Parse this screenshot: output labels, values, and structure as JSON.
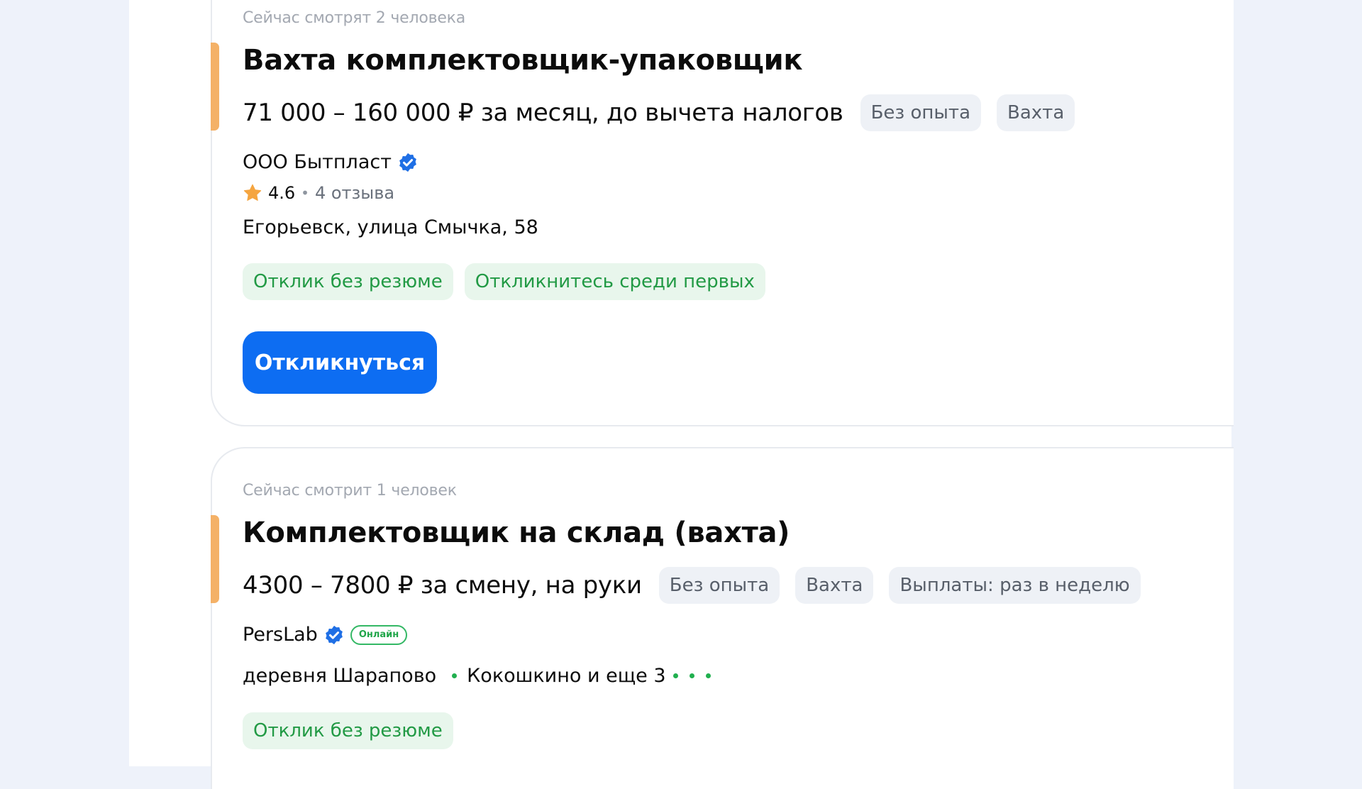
{
  "vacancies": [
    {
      "viewers": "Сейчас смотрят 2 человека",
      "title": "Вахта комплектовщик-упаковщик",
      "salary": "71 000 – 160 000 ₽ за месяц, до вычета налогов",
      "tags": [
        "Без опыта",
        "Вахта"
      ],
      "company": "ООО Бытпласт",
      "rating": "4.6",
      "reviews": "4 отзыва",
      "address": "Егорьевск, улица Смычка, 58",
      "chips": [
        "Отклик без резюме",
        "Откликнитесь среди первых"
      ],
      "apply_label": "Откликнуться"
    },
    {
      "viewers": "Сейчас смотрит 1 человек",
      "title": "Комплектовщик на склад (вахта)",
      "salary": "4300 – 7800 ₽ за смену, на руки",
      "tags": [
        "Без опыта",
        "Вахта",
        "Выплаты: раз в неделю"
      ],
      "company": "PersLab",
      "online_badge": "Онлайн",
      "location_1": "деревня Шарапово",
      "location_2": "Кокошкино и еще 3",
      "chips": [
        "Отклик без резюме"
      ]
    }
  ],
  "colors": {
    "accent_bar": "#f4b167",
    "apply_button": "#0d6df2",
    "verified_icon": "#1f6fe5",
    "chip_green_text": "#229a45",
    "chip_green_bg": "#e8f6ec",
    "rating_star": "#f5a540"
  },
  "icons": [
    "verified-icon",
    "star-icon",
    "metro-dot-icon"
  ]
}
